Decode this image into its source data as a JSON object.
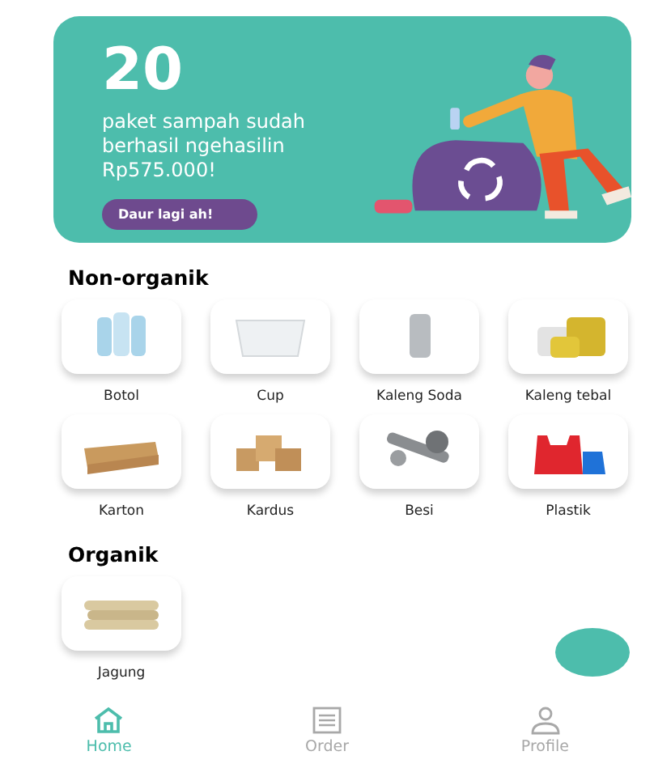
{
  "banner": {
    "count": "20",
    "message": "paket sampah sudah berhasil ngehasilin Rp575.000!",
    "button": "Daur lagi ah!"
  },
  "sections": [
    {
      "title": "Non-organik",
      "items": [
        {
          "label": "Botol",
          "kind": "bottle"
        },
        {
          "label": "Cup",
          "kind": "cup"
        },
        {
          "label": "Kaleng Soda",
          "kind": "can"
        },
        {
          "label": "Kaleng tebal",
          "kind": "tin"
        },
        {
          "label": "Karton",
          "kind": "tray"
        },
        {
          "label": "Kardus",
          "kind": "box"
        },
        {
          "label": "Besi",
          "kind": "metal"
        },
        {
          "label": "Plastik",
          "kind": "bag"
        }
      ]
    },
    {
      "title": "Organik",
      "items": [
        {
          "label": "Jagung",
          "kind": "corn"
        }
      ]
    }
  ],
  "nav": [
    {
      "label": "Home",
      "kind": "home",
      "selected": true
    },
    {
      "label": "Order",
      "kind": "list",
      "selected": false
    },
    {
      "label": "Profile",
      "kind": "person",
      "selected": false
    }
  ]
}
